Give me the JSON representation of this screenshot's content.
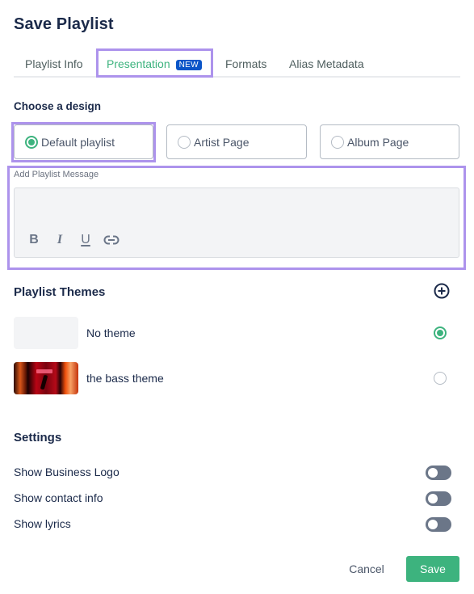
{
  "dialog": {
    "title": "Save Playlist"
  },
  "tabs": [
    {
      "label": "Playlist Info",
      "active": false
    },
    {
      "label": "Presentation",
      "active": true,
      "badge": "NEW"
    },
    {
      "label": "Formats",
      "active": false
    },
    {
      "label": "Alias Metadata",
      "active": false
    }
  ],
  "design": {
    "heading": "Choose a design",
    "options": [
      {
        "label": "Default playlist",
        "selected": true
      },
      {
        "label": "Artist Page",
        "selected": false
      },
      {
        "label": "Album Page",
        "selected": false
      }
    ]
  },
  "message": {
    "label": "Add Playlist Message",
    "value": "",
    "toolbar": {
      "bold": "B",
      "italic": "I",
      "underline": "U",
      "link": "link-icon"
    }
  },
  "themes": {
    "heading": "Playlist Themes",
    "add_icon": "plus-circle-icon",
    "items": [
      {
        "name": "No theme",
        "selected": true,
        "thumbnail": "blank"
      },
      {
        "name": "the bass theme",
        "selected": false,
        "thumbnail": "image"
      }
    ]
  },
  "settings": {
    "heading": "Settings",
    "items": [
      {
        "label": "Show Business Logo",
        "enabled": false
      },
      {
        "label": "Show contact info",
        "enabled": false
      },
      {
        "label": "Show lyrics",
        "enabled": false
      }
    ]
  },
  "footer": {
    "cancel_label": "Cancel",
    "save_label": "Save"
  },
  "colors": {
    "accent": "#3db37e",
    "highlight": "#ad93ec",
    "badge": "#0a55c8",
    "text": "#1b2a4a",
    "toggle_off": "#6b7688"
  }
}
